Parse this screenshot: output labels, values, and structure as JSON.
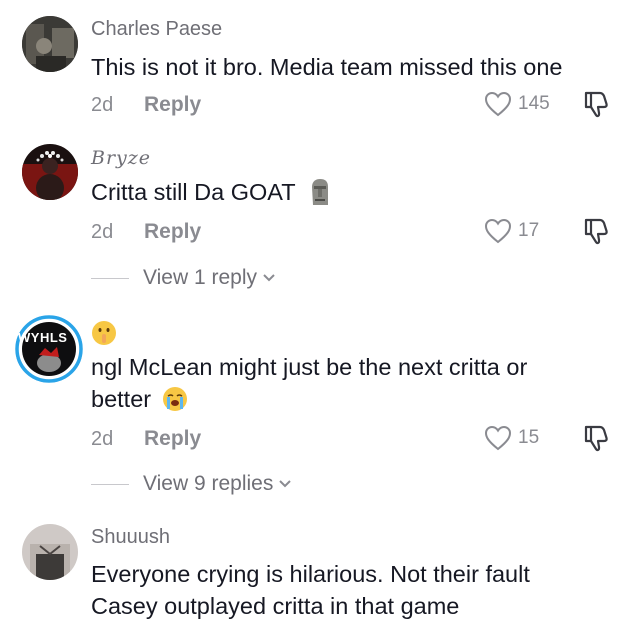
{
  "comments": [
    {
      "username": "Charles Paese",
      "text": "This is not it bro. Media team missed this one",
      "time": "2d",
      "reply_label": "Reply",
      "likes": "145"
    },
    {
      "username": "Bryze",
      "text": "Critta still Da GOAT",
      "time": "2d",
      "reply_label": "Reply",
      "likes": "17",
      "view_replies": "View 1 reply"
    },
    {
      "username": "",
      "avatar_text": "WYHLS",
      "text_line1": "ngl McLean might just be the next critta or",
      "text_line2": "better",
      "time": "2d",
      "reply_label": "Reply",
      "likes": "15",
      "view_replies": "View 9 replies"
    },
    {
      "username": "Shuuush",
      "text_line1": "Everyone crying is hilarious. Not their fault",
      "text_line2": "Casey outplayed critta in that game"
    }
  ],
  "icons": {
    "like": "heart-outline-icon",
    "dislike": "thumbs-down-outline-icon",
    "chevron": "chevron-down-icon"
  },
  "colors": {
    "text": "#161823",
    "muted": "#8a8b91",
    "avatar_ring": "#2aa4e8"
  }
}
